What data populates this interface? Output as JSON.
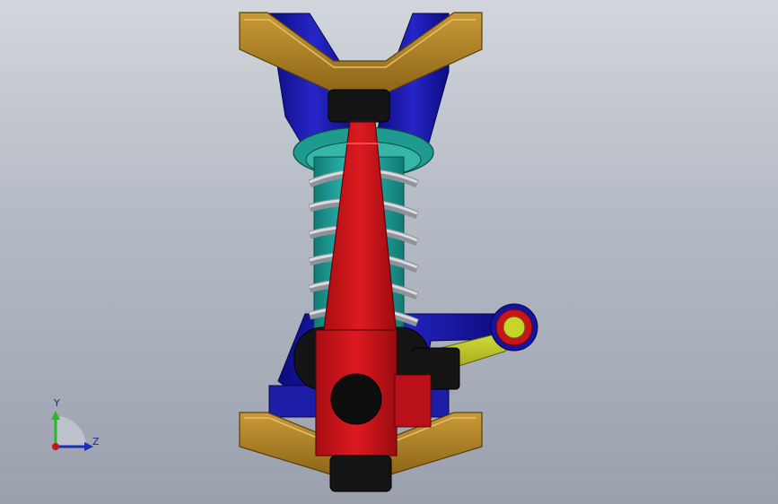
{
  "viewport": {
    "background_top": "#d2d6dc",
    "background_bottom": "#9aa1ad"
  },
  "model": {
    "parts": [
      {
        "name": "upper-control-arm",
        "color": "#b88a2c"
      },
      {
        "name": "lower-control-arm",
        "color": "#b88a2c"
      },
      {
        "name": "suspension-mount",
        "color": "#1c1cb0"
      },
      {
        "name": "coil-spring",
        "color": "#b9bcc0"
      },
      {
        "name": "damper-body",
        "color": "#1fa9a3"
      },
      {
        "name": "spring-seat",
        "color": "#1f9a8e"
      },
      {
        "name": "steering-knuckle",
        "color": "#c8151b"
      },
      {
        "name": "tie-rod",
        "color": "#c9d42a"
      },
      {
        "name": "ball-joint",
        "color": "#111111"
      }
    ]
  },
  "triad": {
    "y_label": "Y",
    "z_label": "Z",
    "y_color": "#2db52d",
    "z_color": "#1c2db8",
    "x_color": "#c8151b"
  }
}
